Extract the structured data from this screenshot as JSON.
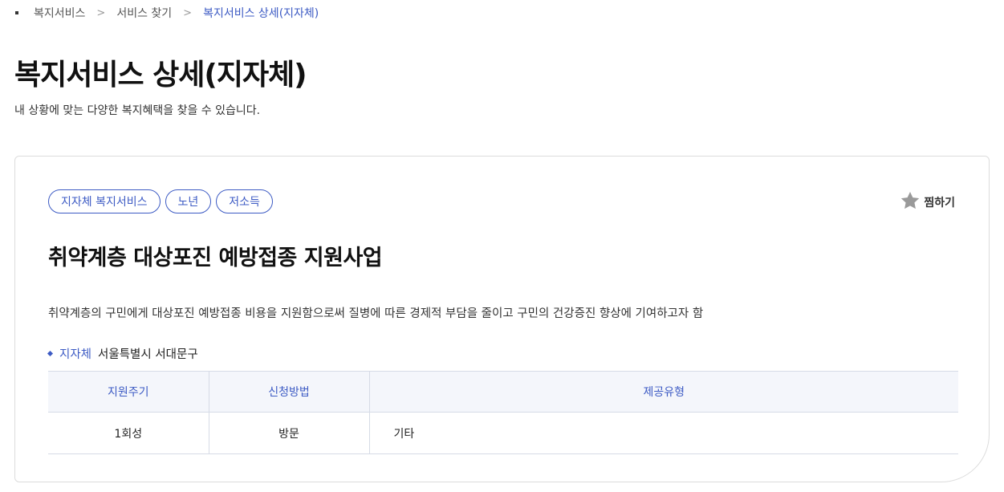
{
  "breadcrumb": {
    "items": [
      "복지서비스",
      "서비스 찾기",
      "복지서비스 상세(지자체)"
    ],
    "separator": ">"
  },
  "page": {
    "title": "복지서비스 상세(지자체)",
    "subtitle": "내 상황에 맞는 다양한 복지혜택을 찾을 수 있습니다."
  },
  "service": {
    "tags": [
      "지자체 복지서비스",
      "노년",
      "저소득"
    ],
    "favorite_label": "찜하기",
    "favorite_icon": "star-icon",
    "title": "취약계층 대상포진 예방접종 지원사업",
    "description": "취약계층의 구민에게 대상포진 예방접종 비용을 지원함으로써 질병에 따른 경제적 부담을 줄이고 구민의 건강증진 향상에 기여하고자 함",
    "region_label": "지자체",
    "region_value": "서울특별시 서대문구"
  },
  "table": {
    "headers": [
      "지원주기",
      "신청방법",
      "제공유형"
    ],
    "rows": [
      [
        "1회성",
        "방문",
        "기타"
      ]
    ]
  },
  "colors": {
    "accent": "#3d5bc4",
    "header_bg": "#f4f6fb",
    "border": "#dcdcdc"
  }
}
